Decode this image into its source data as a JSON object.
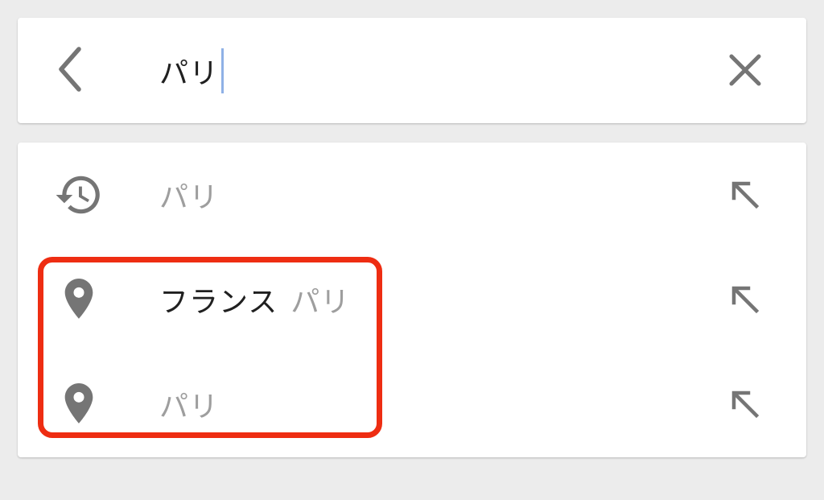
{
  "search": {
    "query": "パリ",
    "back_icon": "arrow-back-icon",
    "clear_icon": "close-icon"
  },
  "suggestions": [
    {
      "icon": "history-icon",
      "primary": "",
      "secondary": "パリ",
      "action_icon": "arrow-up-left-icon"
    },
    {
      "icon": "place-pin-icon",
      "primary": "フランス",
      "secondary": "パリ",
      "action_icon": "arrow-up-left-icon"
    },
    {
      "icon": "place-pin-icon",
      "primary": "",
      "secondary": "パリ",
      "action_icon": "arrow-up-left-icon"
    }
  ],
  "colors": {
    "background": "#ececec",
    "card": "#ffffff",
    "icon": "#757575",
    "caret": "#8fb1e6",
    "highlight": "#ee2d12",
    "primary_text": "#202020",
    "secondary_text": "#9e9e9e"
  }
}
